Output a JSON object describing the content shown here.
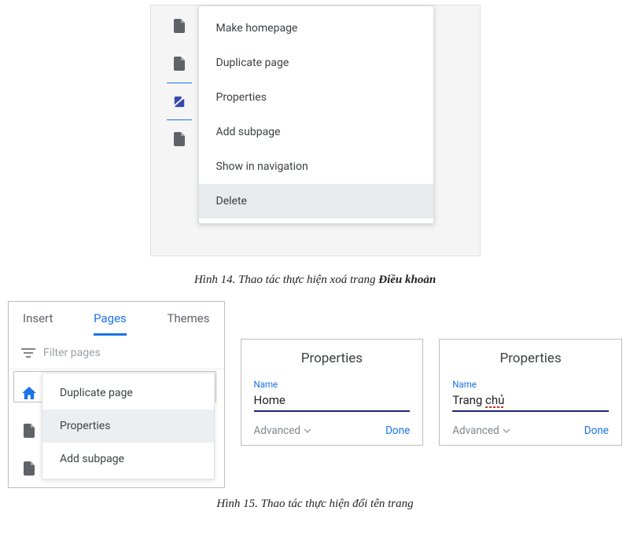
{
  "fig14": {
    "menu": {
      "items": [
        "Make homepage",
        "Duplicate page",
        "Properties",
        "Add subpage",
        "Show in navigation",
        "Delete"
      ],
      "active_index": 5
    },
    "caption_prefix": "Hình 14. Thao tác thực hiện xoá trang ",
    "caption_bold": "Điều khoản"
  },
  "fig15": {
    "tabs": {
      "insert": "Insert",
      "pages": "Pages",
      "themes": "Themes",
      "active": "pages"
    },
    "filter_placeholder": "Filter pages",
    "context_menu": {
      "items": [
        "Duplicate page",
        "Properties",
        "Add subpage"
      ],
      "active_index": 1
    },
    "properties_title": "Properties",
    "name_label": "Name",
    "advanced_label": "Advanced",
    "done_label": "Done",
    "card_a": {
      "name_value": "Home"
    },
    "card_b": {
      "name_value": "Trang chủ",
      "spellcheck_word": "chủ"
    },
    "caption": "Hình 15. Thao tác thực hiện đổi tên trang"
  }
}
